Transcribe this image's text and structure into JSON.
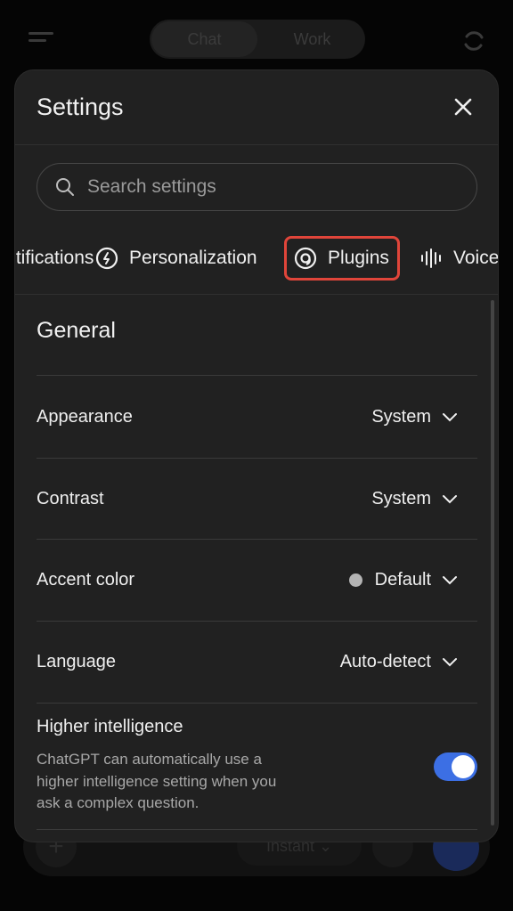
{
  "background": {
    "segment": {
      "chat_label": "Chat",
      "work_label": "Work"
    },
    "composer": {
      "mode_label": "Instant ⌄"
    }
  },
  "settings": {
    "title": "Settings",
    "search_placeholder": "Search settings",
    "tabs": [
      {
        "label": "Notifications",
        "icon": "bell-icon"
      },
      {
        "label": "Personalization",
        "icon": "personalization-icon"
      },
      {
        "label": "Plugins",
        "icon": "plugins-icon",
        "highlighted": true
      },
      {
        "label": "Voice",
        "icon": "voice-waveform-icon"
      }
    ],
    "section_title": "General",
    "rows": [
      {
        "label": "Appearance",
        "value": "System"
      },
      {
        "label": "Contrast",
        "value": "System"
      },
      {
        "label": "Accent color",
        "value": "Default"
      },
      {
        "label": "Language",
        "value": "Auto-detect"
      }
    ],
    "higher_intelligence": {
      "title": "Higher intelligence",
      "description": "ChatGPT can automatically use a higher intelligence setting when you ask a complex question.",
      "enabled": true
    }
  },
  "colors": {
    "modal_bg": "#212121",
    "highlight_border": "#e0453a",
    "toggle_on": "#3c6fe4",
    "accent_dot": "#b4b4b4"
  }
}
